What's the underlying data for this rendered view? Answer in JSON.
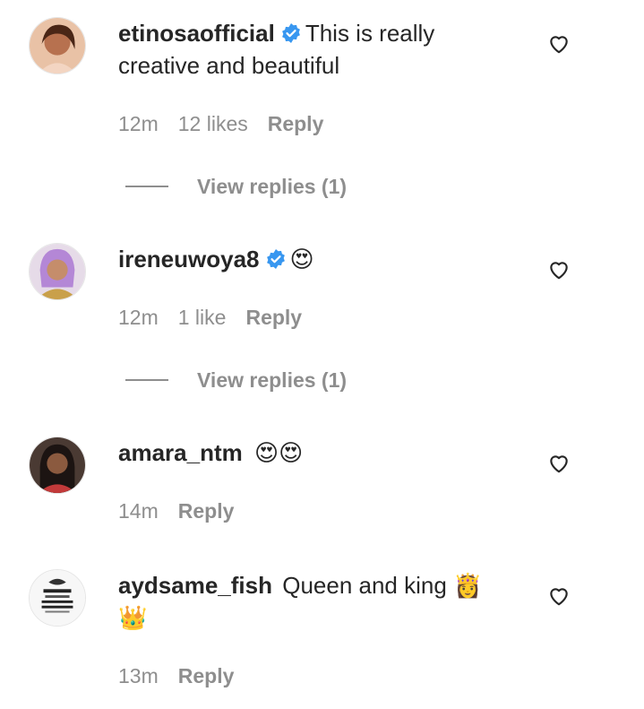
{
  "comments": [
    {
      "username": "etinosaofficial",
      "verified": true,
      "text": "This is really creative and beautiful",
      "time": "12m",
      "likes": "12 likes",
      "reply_label": "Reply",
      "view_replies": "View replies (1)",
      "avatar_color": "#c98a6a"
    },
    {
      "username": "ireneuwoya8",
      "verified": true,
      "text": "😍",
      "time": "12m",
      "likes": "1 like",
      "reply_label": "Reply",
      "view_replies": "View replies (1)",
      "avatar_color": "#c7a2d9"
    },
    {
      "username": "amara_ntm",
      "verified": false,
      "text": "😍😍",
      "time": "14m",
      "reply_label": "Reply",
      "avatar_color": "#3b2a26"
    },
    {
      "username": "aydsame_fish",
      "verified": false,
      "text": "Queen and king 👸 👑",
      "time": "13m",
      "reply_label": "Reply",
      "avatar_color": "#f4f4f4"
    }
  ],
  "colors": {
    "verified_blue": "#3897f0",
    "meta_gray": "#8e8e8e",
    "text_dark": "#262626"
  },
  "icons": {
    "verified": "verified-badge-icon",
    "like": "heart-outline-icon"
  }
}
